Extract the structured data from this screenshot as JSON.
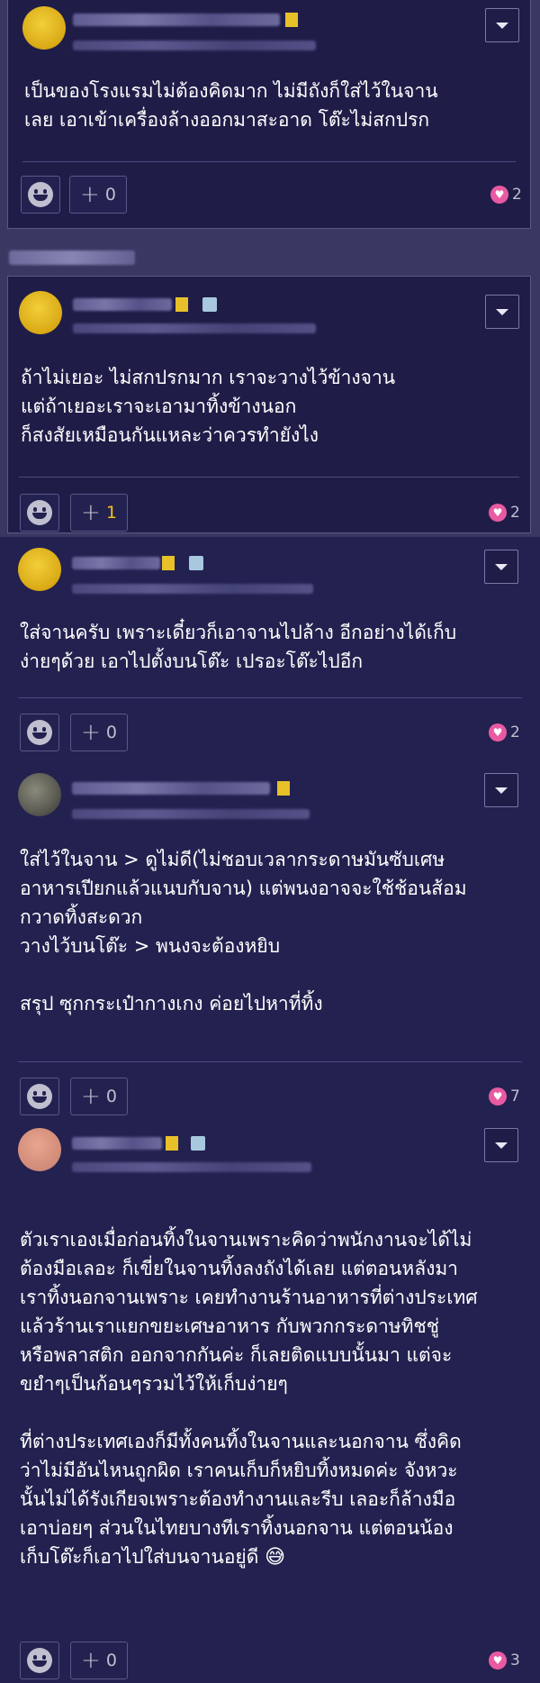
{
  "posts": [
    {
      "text": "เป็นของโรงแรมไม่ต้องคิดมาก  ไม่มีถังก็ใส่ไว้ในจาน\nเลย  เอาเข้าเครื่องล้างออกมาสะอาด  โต๊ะไม่สกปรก",
      "plus_count": "0",
      "plus_active": false,
      "heart_count": "2",
      "avatar": "yellow",
      "badges": [
        "gold"
      ]
    },
    {
      "text": "ถ้าไม่เยอะ ไม่สกปรกมาก เราจะวางไว้ข้างจาน\nแต่ถ้าเยอะเราจะเอามาทิ้งข้างนอก\nก็สงสัยเหมือนกันแหละว่าควรทำยังไง",
      "plus_count": "1",
      "plus_active": true,
      "heart_count": "2",
      "avatar": "yellow",
      "badges": [
        "gold",
        "blue"
      ]
    },
    {
      "text": "ใส่จานครับ เพราะเดี๋ยวก็เอาจานไปล้าง อีกอย่างได้เก็บ\nง่ายๆด้วย เอาไปตั้งบนโต๊ะ เปรอะโต๊ะไปอีก",
      "plus_count": "0",
      "plus_active": false,
      "heart_count": "2",
      "avatar": "yellow",
      "badges": [
        "gold",
        "blue"
      ]
    },
    {
      "text": "ใส่ไว้ในจาน > ดูไม่ดี(ไม่ชอบเวลากระดาษมันซับเศษ\nอาหารเปียกแล้วแนบกับจาน) แต่พนงอาจจะใช้ช้อนส้อม\nกวาดทิ้งสะดวก\nวางไว้บนโต๊ะ > พนงจะต้องหยิบ\n\nสรุป ซุกกระเป๋ากางเกง ค่อยไปหาที่ทิ้ง",
      "plus_count": "0",
      "plus_active": false,
      "heart_count": "7",
      "avatar": "photo",
      "badges": [
        "gold"
      ]
    },
    {
      "text": "ตัวเราเองเมื่อก่อนทิ้งในจานเพราะคิดว่าพนักงานจะได้ไม่\nต้องมือเลอะ ก็เขี่ยในจานทิ้งลงถังได้เลย แต่ตอนหลังมา\nเราทิ้งนอกจานเพราะ เคยทำงานร้านอาหารที่ต่างประเทศ\nแล้วร้านเราแยกขยะเศษอาหาร กับพวกกระดาษทิชชู่\nหรือพลาสติก ออกจากกันค่ะ ก็เลยติดแบบนั้นมา แต่จะ\nขยำๆเป็นก้อนๆรวมไว้ให้เก็บง่ายๆ\n\nที่ต่างประเทศเองก็มีทั้งคนทิ้งในจานและนอกจาน ซึ่งคิด\nว่าไม่มีอันไหนถูกผิด เราคนเก็บก็หยิบทิ้งหมดค่ะ จังหวะ\nนั้นไม่ได้รังเกียจเพราะต้องทำงานและรีบ เลอะก็ล้างมือ\nเอาบ่อยๆ ส่วนในไทยบางทีเราทิ้งนอกจาน แต่ตอนน้อง\nเก็บโต๊ะก็เอาไปใส่บนจานอยู่ดี",
      "emoji": "😅",
      "plus_count": "0",
      "plus_active": false,
      "heart_count": "3",
      "avatar": "pink",
      "badges": [
        "gold",
        "blue"
      ]
    }
  ],
  "icons": {
    "menu": "chevron-down-icon",
    "emotion": "smiley-icon",
    "plus": "plus-icon",
    "heart": "heart-icon"
  },
  "colors": {
    "page_bg": "#3a3862",
    "card_bg": "#1f1d48",
    "heart": "#e85aa2",
    "plus_active": "#f0c020"
  }
}
